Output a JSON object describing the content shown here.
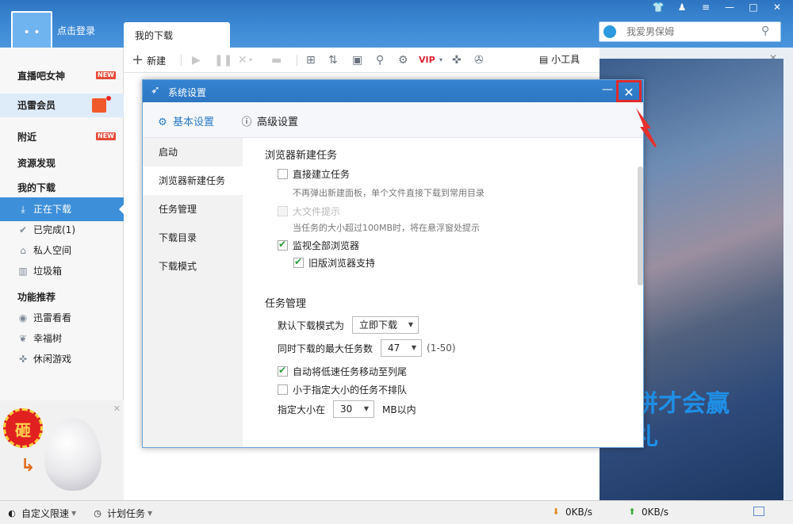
{
  "window": {
    "controls": [
      "👕",
      "♟",
      "≡",
      "—",
      "□",
      "✕"
    ]
  },
  "user": {
    "login_label": "点击登录"
  },
  "tab": {
    "label": "我的下载"
  },
  "search": {
    "placeholder": "我爱男保姆"
  },
  "sidebar": {
    "items": [
      {
        "label": "直播吧女神",
        "badge": "NEW"
      },
      {
        "label": "迅雷会员"
      },
      {
        "label": "附近",
        "badge": "NEW"
      },
      {
        "label": "资源发现"
      },
      {
        "label": "我的下载"
      },
      {
        "label": "正在下载"
      },
      {
        "label": "已完成(1)"
      },
      {
        "label": "私人空间"
      },
      {
        "label": "垃圾箱"
      },
      {
        "label": "功能推荐"
      },
      {
        "label": "迅雷看看"
      },
      {
        "label": "幸福树"
      },
      {
        "label": "休闲游戏"
      }
    ],
    "egg_badge": "砸"
  },
  "toolbar": {
    "new_label": "新建",
    "tools_label": "小工具"
  },
  "dialog": {
    "title": "系统设置",
    "tabs": [
      "基本设置",
      "高级设置"
    ],
    "nav": [
      "启动",
      "浏览器新建任务",
      "任务管理",
      "下载目录",
      "下载模式"
    ],
    "browser_section": {
      "title": "浏览器新建任务",
      "direct": {
        "label": "直接建立任务",
        "checked": false,
        "hint": "不再弹出新建面板，单个文件直接下载到常用目录"
      },
      "bigfile": {
        "label": "大文件提示",
        "checked": false,
        "disabled": true,
        "hint": "当任务的大小超过100MB时，将在悬浮窗处提示"
      },
      "monitor": {
        "label": "监视全部浏览器",
        "checked": true
      },
      "legacy": {
        "label": "旧版浏览器支持",
        "checked": true
      }
    },
    "task_section": {
      "title": "任务管理",
      "mode_label": "默认下载模式为",
      "mode_value": "立即下载",
      "max_label": "同时下载的最大任务数",
      "max_value": "47",
      "max_range": "(1-50)",
      "move_slow": {
        "label": "自动将低速任务移动至列尾",
        "checked": true
      },
      "no_queue": {
        "label": "小于指定大小的任务不排队",
        "checked": false
      },
      "size_label": "指定大小在",
      "size_value": "30",
      "size_unit": "MB以内"
    }
  },
  "ad": {
    "line1": "拼才会赢",
    "line2": "礼"
  },
  "status": {
    "speed_limit": "自定义限速",
    "schedule": "计划任务",
    "down_speed": "0KB/s",
    "up_speed": "0KB/s"
  }
}
